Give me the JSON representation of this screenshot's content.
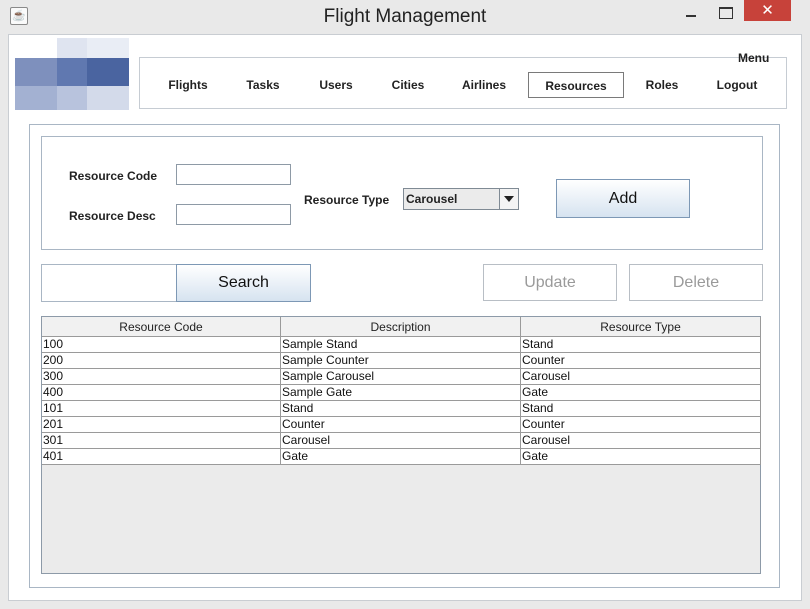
{
  "window": {
    "title": "Flight Management",
    "app_icon": "java-cup-icon",
    "controls": {
      "minimize": "minimize-icon",
      "maximize": "maximize-icon",
      "close": "✕"
    }
  },
  "menu": {
    "label": "Menu",
    "items": [
      "Flights",
      "Tasks",
      "Users",
      "Cities",
      "Airlines",
      "Resources",
      "Roles",
      "Logout"
    ],
    "active": "Resources"
  },
  "form": {
    "code_label": "Resource Code",
    "desc_label": "Resource Desc",
    "code_value": "",
    "desc_value": "",
    "type_label": "Resource Type",
    "type_value": "Carousel",
    "add_label": "Add"
  },
  "search": {
    "value": "",
    "button_label": "Search"
  },
  "actions": {
    "update_label": "Update",
    "delete_label": "Delete"
  },
  "table": {
    "columns": [
      "Resource Code",
      "Description",
      "Resource Type"
    ],
    "rows": [
      [
        "100",
        "Sample Stand",
        "Stand"
      ],
      [
        "200",
        "Sample Counter",
        "Counter"
      ],
      [
        "300",
        "Sample Carousel",
        "Carousel"
      ],
      [
        "400",
        "Sample Gate",
        "Gate"
      ],
      [
        "101",
        "Stand",
        "Stand"
      ],
      [
        "201",
        "Counter",
        "Counter"
      ],
      [
        "301",
        "Carousel",
        "Carousel"
      ],
      [
        "401",
        "Gate",
        "Gate"
      ]
    ]
  },
  "colors": {
    "close": "#c7423a",
    "logo_dark": "#4a64a0",
    "logo_mid": "#7e90bd",
    "logo_light": "#c9d1e6"
  }
}
